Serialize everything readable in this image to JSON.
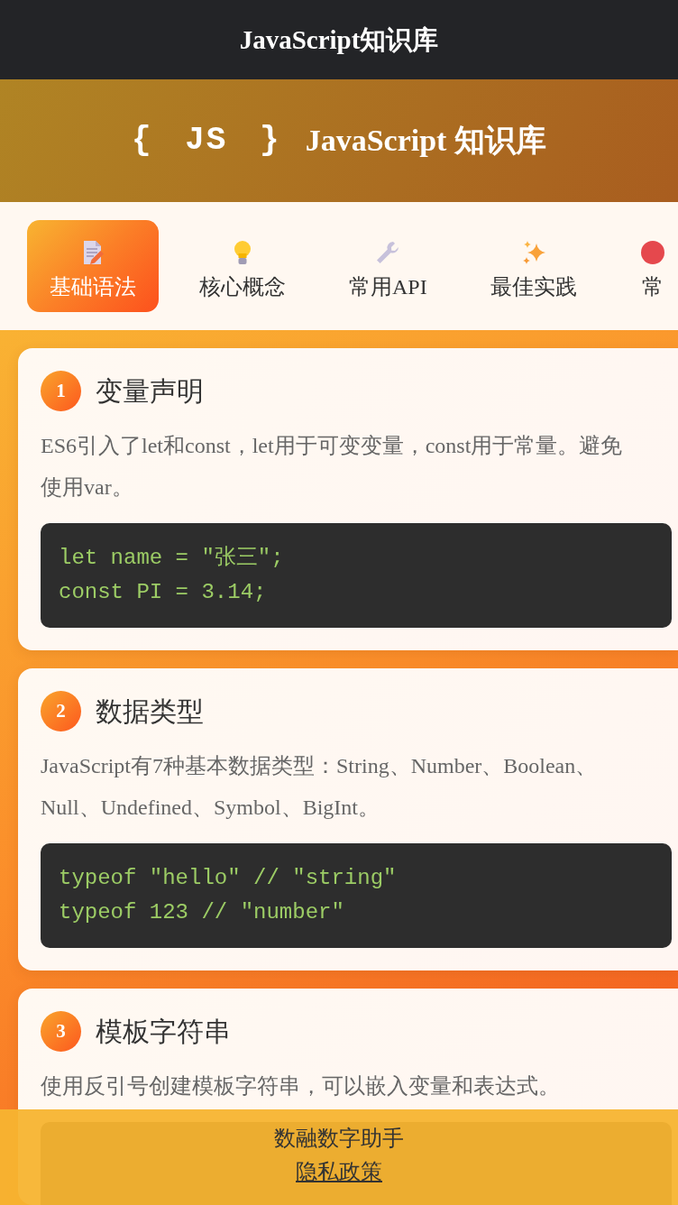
{
  "app_bar": {
    "title": "JavaScript知识库"
  },
  "hero": {
    "logo": "{ JS }",
    "title": "JavaScript 知识库"
  },
  "tabs": [
    {
      "label": "基础语法",
      "selected": true
    },
    {
      "label": "核心概念",
      "selected": false
    },
    {
      "label": "常用API",
      "selected": false
    },
    {
      "label": "最佳实践",
      "selected": false
    },
    {
      "label": "常",
      "selected": false
    }
  ],
  "cards": [
    {
      "number": "1",
      "title": "变量声明",
      "text": "ES6引入了let和const，let用于可变变量，const用于常量。避免使用var。",
      "code": [
        "let name = \"张三\";",
        "const PI = 3.14;"
      ]
    },
    {
      "number": "2",
      "title": "数据类型",
      "text": "JavaScript有7种基本数据类型：String、Number、Boolean、Null、Undefined、Symbol、BigInt。",
      "code": [
        "typeof \"hello\" // \"string\"",
        "typeof 123 // \"number\""
      ]
    },
    {
      "number": "3",
      "title": "模板字符串",
      "text": "使用反引号创建模板字符串，可以嵌入变量和表达式。"
    }
  ],
  "footer": {
    "text": "数融数字助手",
    "link": "隐私政策"
  }
}
